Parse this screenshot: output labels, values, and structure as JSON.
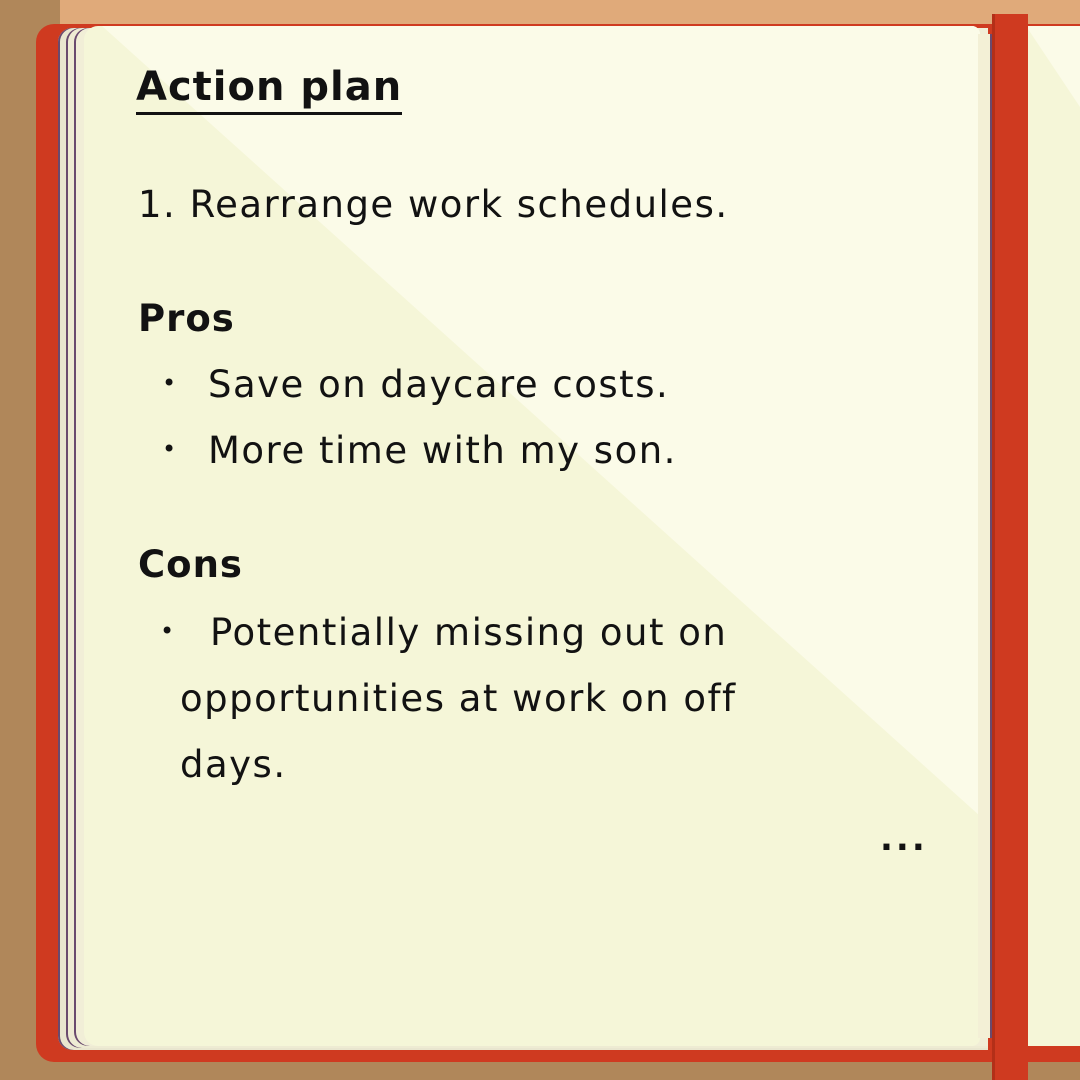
{
  "notebook": {
    "title": "Action plan",
    "plan_item": "1. Rearrange work schedules.",
    "pros": {
      "heading": "Pros",
      "items": [
        "Save on daycare costs.",
        "More time with my son."
      ]
    },
    "cons": {
      "heading": "Cons",
      "items": [
        {
          "lines": [
            "Potentially missing out on",
            "opportunities at work on off",
            "days."
          ]
        }
      ]
    },
    "continuation": "...",
    "bullet": "•"
  },
  "colors": {
    "cover": "#cf3a20",
    "page": "#f5f6d8",
    "ink": "#121212",
    "table": "#b0875a"
  }
}
